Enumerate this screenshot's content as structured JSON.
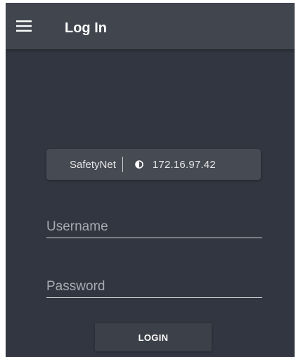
{
  "app": {
    "title": "Log In",
    "menu_icon": "hamburger-menu-icon"
  },
  "network_info": {
    "name": "SafetyNet",
    "ip_icon": "shield-icon",
    "ip_address": "172.16.97.42"
  },
  "form": {
    "username": {
      "value": "",
      "placeholder": "Username"
    },
    "password": {
      "value": "",
      "placeholder": "Password"
    },
    "login_label": "LOGIN"
  },
  "colors": {
    "background": "#323640",
    "topbar": "#41454d",
    "card": "#464a52",
    "button": "#3c4048",
    "text": "#ffffff"
  }
}
